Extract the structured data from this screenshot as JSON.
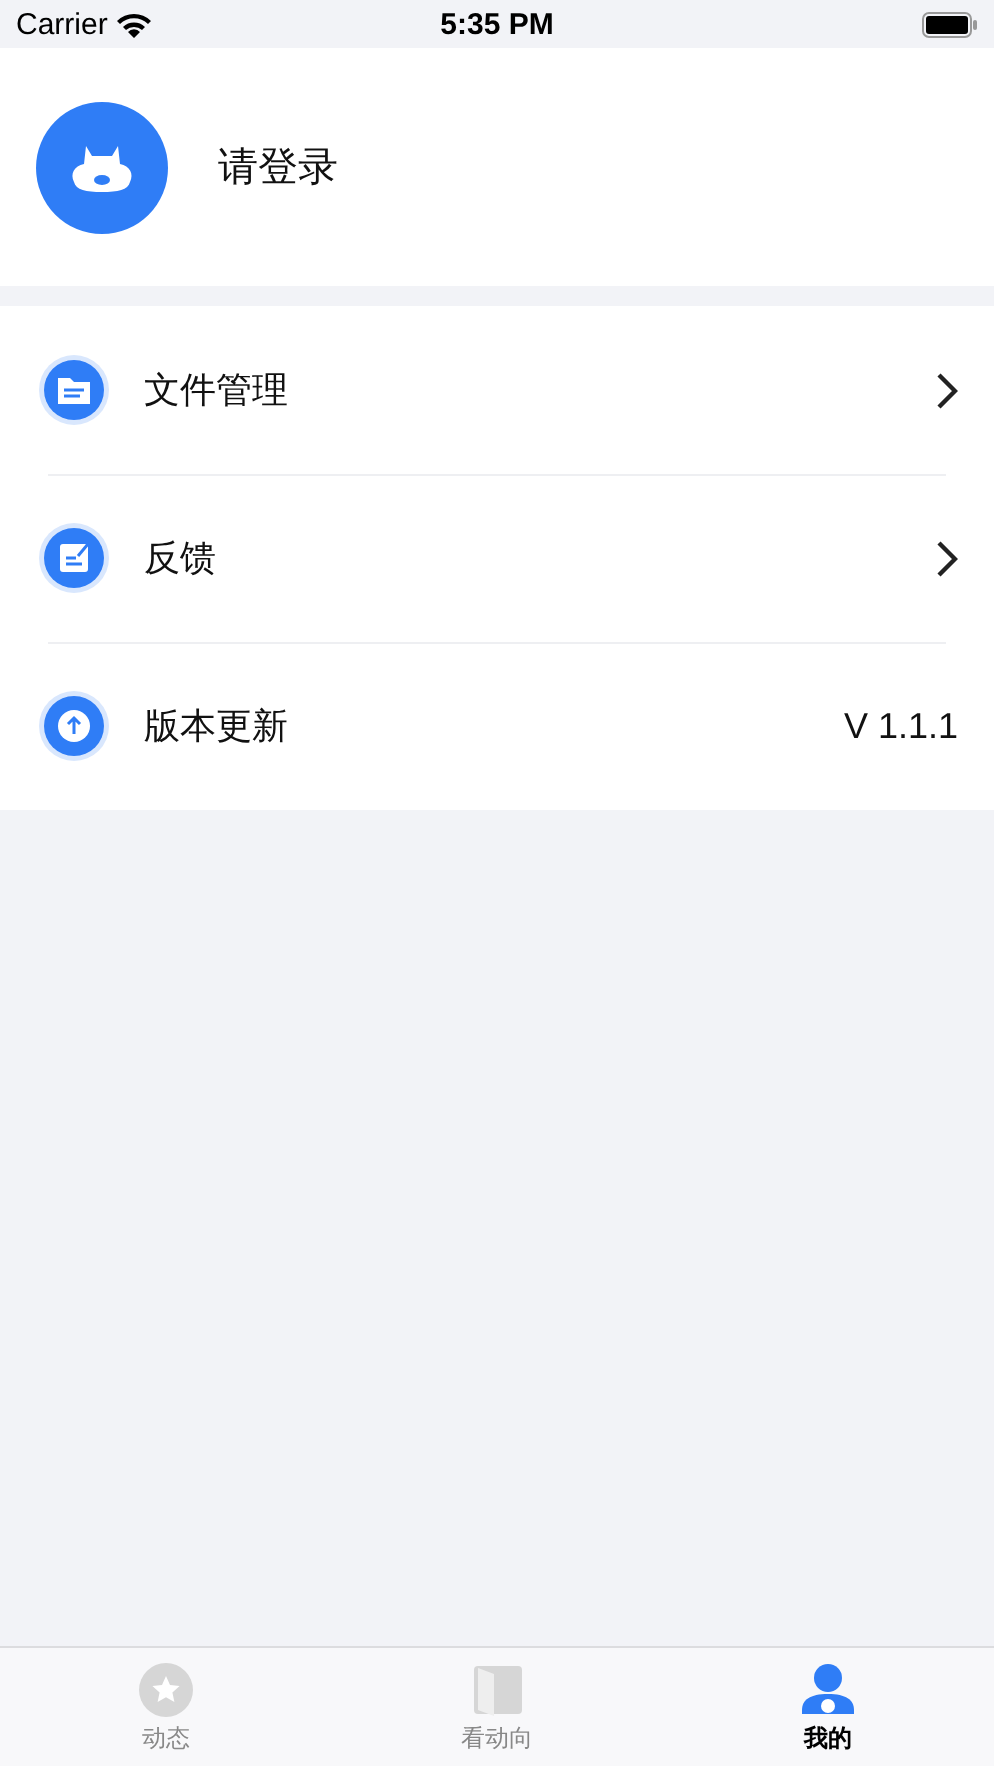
{
  "status_bar": {
    "carrier": "Carrier",
    "time": "5:35 PM"
  },
  "profile": {
    "name": "请登录"
  },
  "menu": [
    {
      "label": "文件管理",
      "kind": "link"
    },
    {
      "label": "反馈",
      "kind": "link"
    },
    {
      "label": "版本更新",
      "kind": "value",
      "value": "V 1.1.1"
    }
  ],
  "tab_bar": [
    {
      "label": "动态",
      "selected": false
    },
    {
      "label": "看动向",
      "selected": false
    },
    {
      "label": "我的",
      "selected": true
    }
  ]
}
